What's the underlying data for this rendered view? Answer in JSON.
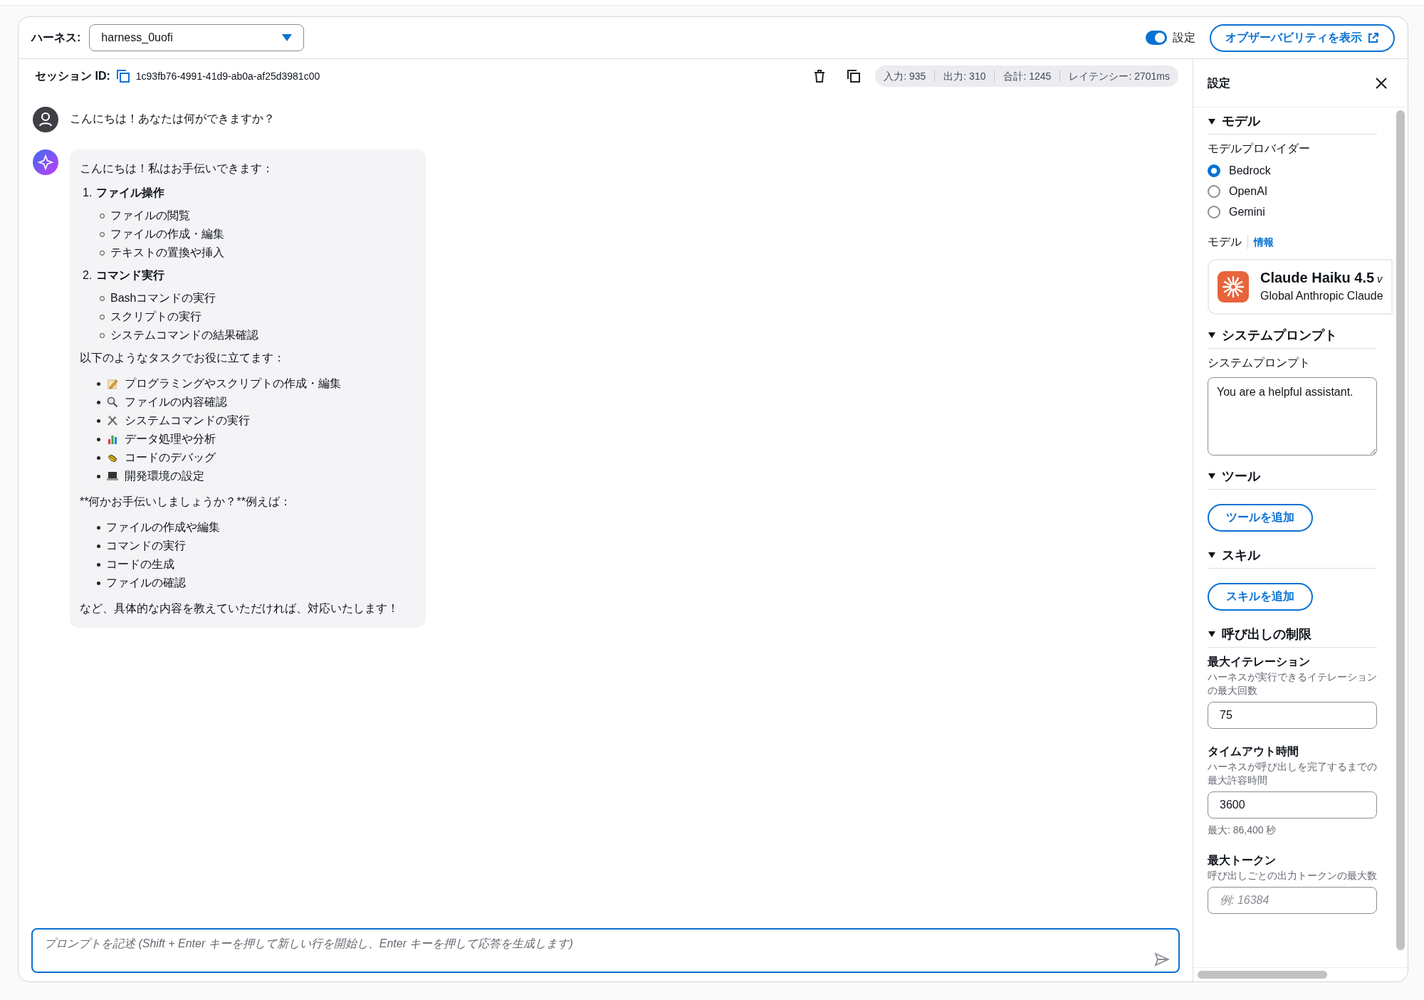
{
  "header": {
    "harness_label": "ハーネス:",
    "harness_value": "harness_0uofi",
    "settings_toggle": {
      "label": "設定",
      "on": true
    },
    "observability_button": "オブザーバビリティを表示"
  },
  "session": {
    "label": "セッション ID:",
    "id": "1c93fb76-4991-41d9-ab0a-af25d3981c00",
    "stats": [
      "入力: 935",
      "出力: 310",
      "合計: 1245",
      "レイテンシー: 2701ms"
    ]
  },
  "messages": [
    {
      "kind": "user",
      "blocks": [
        {
          "kind": "paragraph",
          "text": "こんにちは！あなたは何ができますか？"
        }
      ]
    },
    {
      "kind": "assistant",
      "blocks": [
        {
          "kind": "paragraph",
          "text": "こんにちは！私はお手伝いできます："
        },
        {
          "kind": "ordered",
          "items": [
            {
              "number": "1.",
              "title": "ファイル操作",
              "children": [
                "ファイルの閲覧",
                "ファイルの作成・編集",
                "テキストの置換や挿入"
              ]
            },
            {
              "number": "2.",
              "title": "コマンド実行",
              "children": [
                "Bashコマンドの実行",
                "スクリプトの実行",
                "システムコマンドの結果確認"
              ]
            }
          ]
        },
        {
          "kind": "paragraph",
          "text": "以下のようなタスクでお役に立てます："
        },
        {
          "kind": "icon_bullets",
          "items": [
            "プログラミングやスクリプトの作成・編集",
            "ファイルの内容確認",
            "システムコマンドの実行",
            "データ処理や分析",
            "コードのデバッグ",
            "開発環境の設定"
          ]
        },
        {
          "kind": "paragraph",
          "text": "**何かお手伝いしましょうか？**例えば："
        },
        {
          "kind": "bullets",
          "items": [
            "ファイルの作成や編集",
            "コマンドの実行",
            "コードの生成",
            "ファイルの確認"
          ]
        },
        {
          "kind": "paragraph",
          "text": "など、具体的な内容を教えていただければ、対応いたします！"
        }
      ]
    }
  ],
  "prompt": {
    "placeholder": "プロンプトを記述 (Shift + Enter キーを押して新しい行を開始し、Enter キーを押して応答を生成します)"
  },
  "settings_panel": {
    "title": "設定",
    "sections": [
      {
        "kind": "model",
        "title": "モデル",
        "expanded": true,
        "provider_label": "モデルプロバイダー",
        "providers": [
          {
            "label": "Bedrock",
            "selected": true
          },
          {
            "label": "OpenAI",
            "selected": false
          },
          {
            "label": "Gemini",
            "selected": false
          }
        ],
        "model_label": "モデル",
        "info_link": "情報",
        "model_name": "Claude Haiku 4.5",
        "model_tag": "v",
        "model_provider": "Global Anthropic Claude"
      },
      {
        "kind": "prompt",
        "title": "システムプロンプト",
        "expanded": true,
        "label": "システムプロンプト",
        "value": "You are a helpful assistant."
      },
      {
        "kind": "button",
        "title": "ツール",
        "expanded": true,
        "button": "ツールを追加"
      },
      {
        "kind": "button",
        "title": "スキル",
        "expanded": true,
        "button": "スキルを追加"
      },
      {
        "kind": "limits",
        "title": "呼び出しの制限",
        "expanded": true,
        "fields": [
          {
            "label": "最大イテレーション",
            "description": "ハーネスが実行できるイテレーションの最大回数",
            "value": "75"
          },
          {
            "label": "タイムアウト時間",
            "description": "ハーネスが呼び出しを完了するまでの最大許容時間",
            "value": "3600",
            "hint": "最大: 86,400 秒"
          },
          {
            "label": "最大トークン",
            "description": "呼び出しごとの出力トークンの最大数",
            "placeholder": "例: 16384"
          }
        ]
      }
    ]
  }
}
